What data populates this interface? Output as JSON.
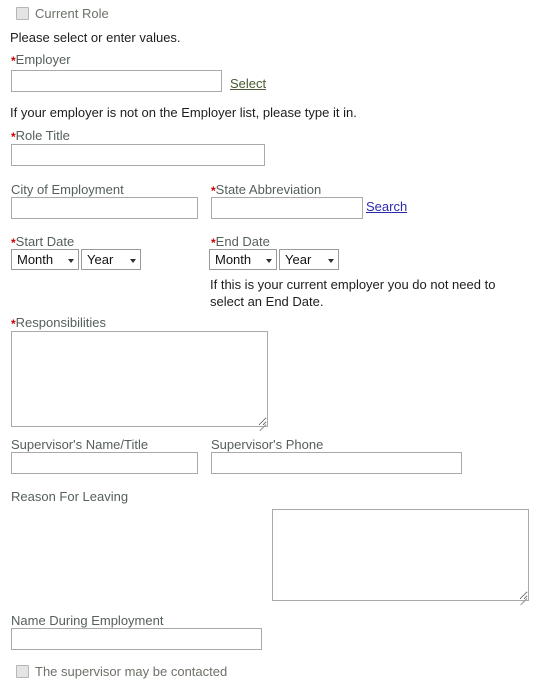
{
  "form": {
    "current_role": {
      "label": "Current Role",
      "checked": false
    },
    "instruction": "Please select or enter values.",
    "employer": {
      "label": "Employer",
      "required": true,
      "value": "",
      "placeholder": "",
      "select_link": "Select",
      "help": "If your employer is not on the Employer list, please type it in."
    },
    "role_title": {
      "label": "Role Title",
      "required": true,
      "value": "",
      "placeholder": ""
    },
    "city_of_employment": {
      "label": "City of Employment",
      "required": false,
      "value": "",
      "placeholder": ""
    },
    "state_abbreviation": {
      "label": "State Abbreviation",
      "required": true,
      "value": "",
      "placeholder": "",
      "search_link": "Search"
    },
    "start_date": {
      "label": "Start Date",
      "required": true,
      "month": "Month",
      "year": "Year"
    },
    "end_date": {
      "label": "End Date",
      "required": true,
      "month": "Month",
      "year": "Year",
      "help": "If this is your current employer you do not need to select an End Date."
    },
    "responsibilities": {
      "label": "Responsibilities",
      "required": true,
      "value": "",
      "placeholder": ""
    },
    "supervisor_name_title": {
      "label": "Supervisor's Name/Title",
      "required": false,
      "value": "",
      "placeholder": ""
    },
    "supervisor_phone": {
      "label": "Supervisor's Phone",
      "required": false,
      "value": "",
      "placeholder": ""
    },
    "reason_for_leaving": {
      "label": "Reason For Leaving",
      "required": false,
      "value": "",
      "placeholder": ""
    },
    "name_during_employment": {
      "label": "Name During Employment",
      "required": false,
      "value": "",
      "placeholder": ""
    },
    "supervisor_contact": {
      "label": "The supervisor may be contacted",
      "checked": false
    }
  },
  "icons": {
    "required_marker": "*",
    "caret": "▾"
  },
  "colors": {
    "required_red": "#cc0000",
    "label_olive": "#55605a",
    "link_select_green": "#4a5a32",
    "link_search_blue": "#2a2ab0",
    "input_border": "#a9a9a9",
    "checkbox_fill": "#e4e4e4",
    "body_text": "#1d1d1d"
  }
}
